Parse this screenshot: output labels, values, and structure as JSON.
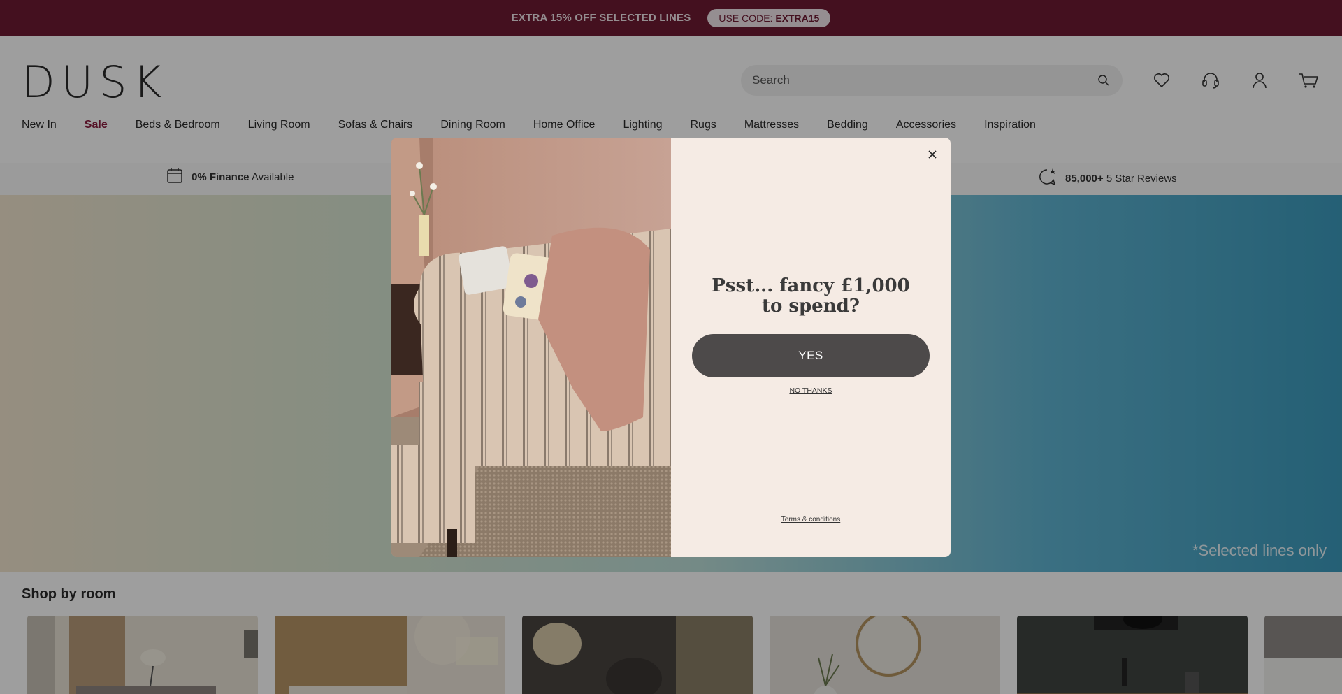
{
  "promo": {
    "text": "EXTRA 15% OFF SELECTED LINES",
    "code_label": "USE CODE:",
    "code": "EXTRA15"
  },
  "header": {
    "logo": "DUSK",
    "search_placeholder": "Search",
    "icons": [
      "heart-icon",
      "headset-icon",
      "user-icon",
      "basket-icon"
    ]
  },
  "nav": [
    "New In",
    "Sale",
    "Beds & Bedroom",
    "Living Room",
    "Sofas & Chairs",
    "Dining Room",
    "Home Office",
    "Lighting",
    "Rugs",
    "Mattresses",
    "Bedding",
    "Accessories",
    "Inspiration"
  ],
  "usp": {
    "finance_bold": "0% Finance",
    "finance_text": "Available",
    "reviews_bold": "85,000+",
    "reviews_text": "5 Star Reviews"
  },
  "hero": {
    "note": "*Selected lines only"
  },
  "shop": {
    "title": "Shop by room"
  },
  "modal": {
    "headline": "Psst... fancy £1,000 to spend?",
    "yes_label": "YES",
    "no_label": "NO THANKS",
    "terms_label": "Terms & conditions"
  },
  "colors": {
    "promo_bg": "#6e1a33",
    "sale": "#8a1c3e",
    "yes_button": "#4d4a4a",
    "modal_bg": "#f5ebe4"
  }
}
